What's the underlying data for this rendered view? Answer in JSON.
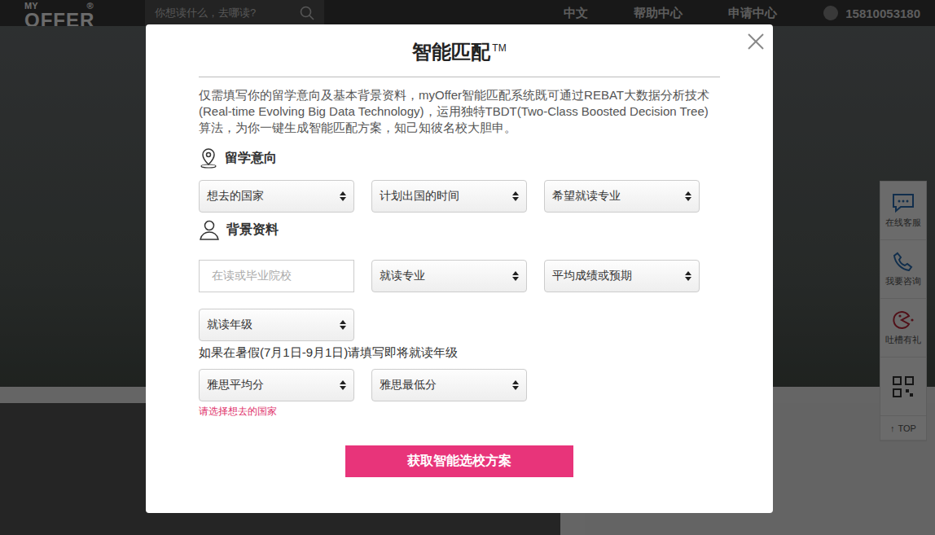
{
  "header": {
    "logo_top": "MY",
    "logo_mark": "®",
    "logo_bottom": "OFFER",
    "search_placeholder": "你想读什么，去哪读?",
    "nav": [
      "中文",
      "帮助中心",
      "申请中心"
    ],
    "phone": "15810053180"
  },
  "sidebar": [
    {
      "label": "在线客服"
    },
    {
      "label": "我要咨询"
    },
    {
      "label": "吐槽有礼"
    },
    {
      "label": ""
    },
    {
      "label": "TOP",
      "glyph": "↑"
    }
  ],
  "modal": {
    "title": "智能匹配",
    "title_mark": "TM",
    "description": "仅需填写你的留学意向及基本背景资料，myOffer智能匹配系统既可通过REBAT大数据分析技术 (Real-time Evolving Big Data Technology)，运用独特TBDT(Two-Class Boosted Decision Tree)算法，为你一键生成智能匹配方案，知己知彼名校大胆申。",
    "intent": {
      "title": "留学意向",
      "fields": [
        {
          "kind": "select",
          "placeholder": "想去的国家"
        },
        {
          "kind": "select",
          "placeholder": "计划出国的时间"
        },
        {
          "kind": "select",
          "placeholder": "希望就读专业"
        }
      ]
    },
    "background": {
      "title": "背景资料",
      "rows": [
        {
          "kind": "fields",
          "fields": [
            {
              "kind": "input",
              "placeholder": "在读或毕业院校"
            },
            {
              "kind": "select",
              "placeholder": "就读专业"
            },
            {
              "kind": "select",
              "placeholder": "平均成绩或预期"
            }
          ]
        },
        {
          "kind": "fields",
          "fields": [
            {
              "kind": "select",
              "placeholder": "就读年级"
            }
          ]
        },
        {
          "kind": "note",
          "text": "如果在暑假(7月1日-9月1日)请填写即将就读年级"
        },
        {
          "kind": "fields",
          "fields": [
            {
              "kind": "select",
              "placeholder": "雅思平均分"
            },
            {
              "kind": "select",
              "placeholder": "雅思最低分"
            }
          ]
        }
      ]
    },
    "error": "请选择想去的国家",
    "submit": "获取智能选校方案"
  }
}
